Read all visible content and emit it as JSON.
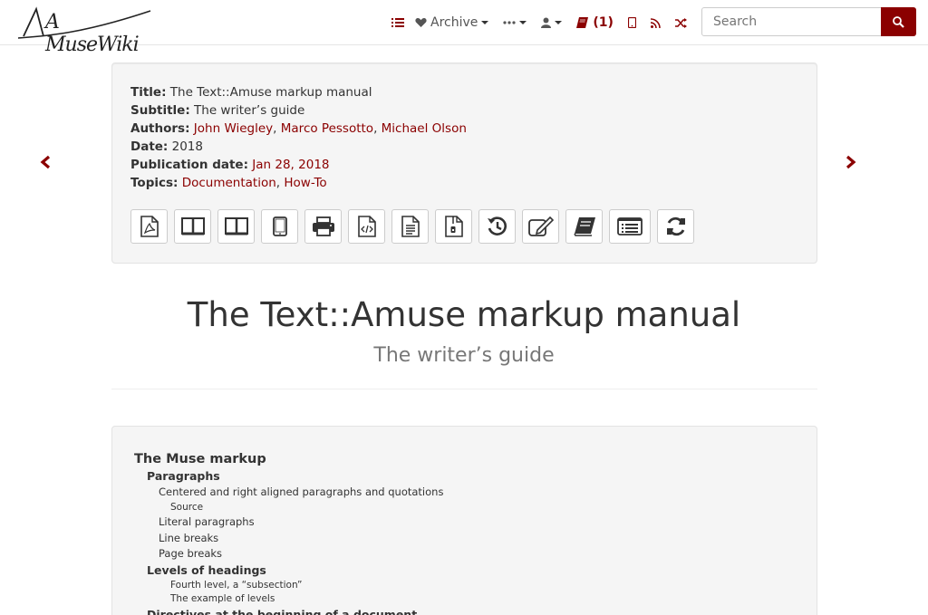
{
  "nav": {
    "logo_text": "A MuseWiki",
    "archive_label": "Archive",
    "bookbuilder_count": "(1)",
    "search_placeholder": "Search"
  },
  "info": {
    "title_key": "Title:",
    "title_val": "The Text::Amuse markup manual",
    "subtitle_key": "Subtitle:",
    "subtitle_val": "The writer’s guide",
    "authors_key": "Authors:",
    "authors": [
      "John Wiegley",
      "Marco Pessotto",
      "Michael Olson"
    ],
    "date_key": "Date:",
    "date_val": "2018",
    "pubdate_key": "Publication date:",
    "pubdate_val": "Jan 28, 2018",
    "topics_key": "Topics:",
    "topics": [
      "Documentation",
      "How-To"
    ]
  },
  "toolbar_icons": [
    "pdf-icon",
    "book-open-icon",
    "book-imposed-icon",
    "tablet-icon",
    "print-icon",
    "source-code-icon",
    "plain-text-icon",
    "zip-archive-icon",
    "history-icon",
    "edit-icon",
    "bookbuilder-icon",
    "slides-icon",
    "refresh-icon"
  ],
  "heading": {
    "title": "The Text::Amuse markup manual",
    "subtitle": "The writer’s guide"
  },
  "toc": [
    {
      "level": 1,
      "text": "The Muse markup"
    },
    {
      "level": 2,
      "text": "Paragraphs"
    },
    {
      "level": 3,
      "text": "Centered and right aligned paragraphs and quotations"
    },
    {
      "level": 4,
      "text": "Source"
    },
    {
      "level": 3,
      "text": "Literal paragraphs"
    },
    {
      "level": 3,
      "text": "Line breaks"
    },
    {
      "level": 3,
      "text": "Page breaks"
    },
    {
      "level": 2,
      "text": "Levels of headings"
    },
    {
      "level": 4,
      "text": "Fourth level, a “subsection”"
    },
    {
      "level": 4,
      "text": "The example of levels"
    },
    {
      "level": 2,
      "text": "Directives at the beginning of a document"
    }
  ],
  "colors": {
    "accent": "#8b0000",
    "panel_bg": "#f5f5f5"
  }
}
